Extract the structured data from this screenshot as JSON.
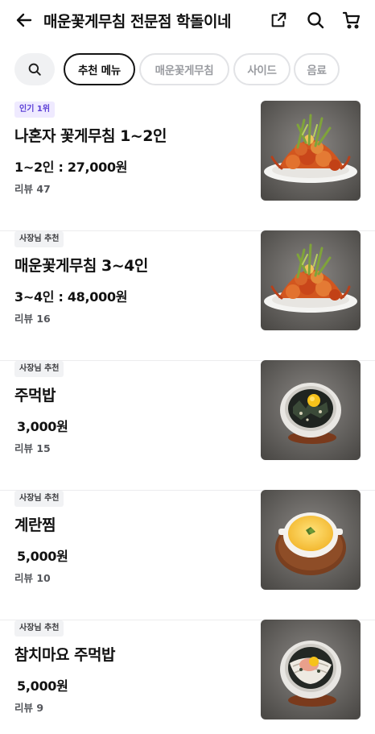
{
  "header": {
    "title": "매운꽃게무침 전문점 학돌이네"
  },
  "tabs": [
    {
      "label": "추천 메뉴",
      "active": true
    },
    {
      "label": "매운꽃게무침",
      "active": false
    },
    {
      "label": "사이드",
      "active": false
    },
    {
      "label": "음료",
      "active": false
    }
  ],
  "menu": [
    {
      "badge": "인기 1위",
      "badge_color": "#5b3fd6",
      "name": "나혼자 꽃게무침 1~2인",
      "price": "1~2인 : 27,000원",
      "review": "리뷰 47",
      "image": "spicy-crab-plate-icon"
    },
    {
      "badge": "사장님 추천",
      "badge_color": "#3a3a3d",
      "name": "매운꽃게무침 3~4인",
      "price": "3~4인 : 48,000원",
      "review": "리뷰 16",
      "image": "spicy-crab-plate-icon"
    },
    {
      "badge": "사장님 추천",
      "badge_color": "#3a3a3d",
      "name": "주먹밥",
      "price": "3,000원",
      "review": "리뷰 15",
      "image": "rice-ball-bowl-icon"
    },
    {
      "badge": "사장님 추천",
      "badge_color": "#3a3a3d",
      "name": "계란찜",
      "price": "5,000원",
      "review": "리뷰 10",
      "image": "steamed-egg-icon"
    },
    {
      "badge": "사장님 추천",
      "badge_color": "#3a3a3d",
      "name": "참치마요 주먹밥",
      "price": "5,000원",
      "review": "리뷰 9",
      "image": "tuna-mayo-rice-icon"
    }
  ]
}
